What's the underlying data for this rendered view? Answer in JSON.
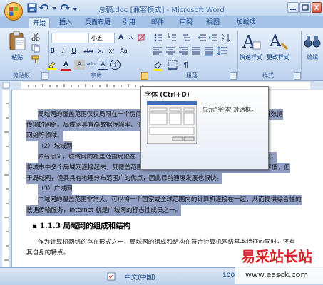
{
  "window": {
    "title": "总稿.doc [兼容模式] - Microsoft Word",
    "colors": {
      "ribbon": "#c9dbf1",
      "selection": "#8f9ec2",
      "accent": "#15428b"
    }
  },
  "tabs": [
    {
      "label": "开始",
      "active": true
    },
    {
      "label": "插入"
    },
    {
      "label": "页面布局"
    },
    {
      "label": "引用"
    },
    {
      "label": "邮件"
    },
    {
      "label": "审阅"
    },
    {
      "label": "视图"
    },
    {
      "label": "加载项"
    }
  ],
  "ribbon": {
    "clipboard": {
      "paste_label": "粘贴",
      "group_label": "剪贴板"
    },
    "font": {
      "font_name": "",
      "font_size": "小五",
      "bold": "B",
      "italic": "I",
      "underline": "U",
      "strikethrough": "abe",
      "subscript": "x₂",
      "superscript": "x²",
      "change_case": "Aa",
      "grow_font": "A",
      "shrink_font": "A",
      "phonetic": "wén",
      "char_border": "A",
      "char_shading": "A",
      "enclose": "字",
      "font_color": "A",
      "group_label": "字体"
    },
    "paragraph": {
      "group_label": "段落"
    },
    "styles": {
      "quick_styles_label": "快速样式",
      "change_styles_label": "更改样式",
      "group_label": "样式"
    },
    "editing": {
      "label": "编辑"
    }
  },
  "tooltip": {
    "title": "字体 (Ctrl+D)",
    "description": "显示“字体”对话框。"
  },
  "document": {
    "lines": [
      {
        "text": "局域网的覆盖范围仅仅局限在一个房间、一栋大楼或一个园区，利用高速通信网络进行数据",
        "selected": true
      },
      {
        "text": "传输的网络。局域网具有高数据传输率、低延迟和低误码率的特点。学校、单位办公",
        "selected": true
      },
      {
        "text": "网络等领域。",
        "selected": true
      },
      {
        "text": "（2）城域网",
        "selected": true
      },
      {
        "text": "顾名思义，城域网的覆盖范围局限在一个城市的范围内，城域网的传输介质主要是光纤，",
        "selected": true
      },
      {
        "text": "将城市中多个局域网连接起来，其覆盖范围可以达到几十千米，其传输速率比局域网的速率低，但",
        "selected": true
      },
      {
        "text": "于局域网，但其具有地理分布范围广的优点，因此目前速度发展也很快。",
        "selected": true
      },
      {
        "text": "（3）广域网",
        "selected": true
      },
      {
        "text": "广域网的覆盖范围非常大，可以将一个国家或全球范围内的计算机连接在一起，从而提供综合性的",
        "selected": true
      },
      {
        "text": "数据传输服务，Internet 就是广域网的标志性成员之一。",
        "selected": true
      }
    ],
    "heading": "1.1.3  局域网的组成和结构",
    "after_heading": [
      "作为计算机网络的存在形式之一，局域网的组成和结构在符合计算机网络基本特征的同时，还有",
      "其自身的特点。"
    ]
  },
  "statusbar": {
    "language": "中文(中国)",
    "zoom": "100%"
  },
  "watermark": {
    "brand": "易采站长站",
    "url": "www.easck.com"
  }
}
